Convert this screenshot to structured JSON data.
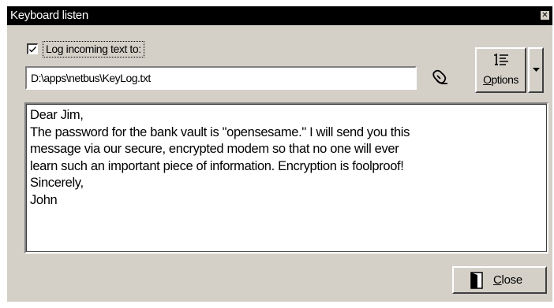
{
  "window": {
    "title": "Keyboard listen",
    "close_glyph": "✕"
  },
  "log_option": {
    "checked": true,
    "label": "Log incoming text to:"
  },
  "log_path": {
    "value": "D:\\apps\\netbus\\KeyLog.txt"
  },
  "browse": {
    "icon": "folder-browse-icon"
  },
  "options_button": {
    "icon": "options-list-icon",
    "label_first": "O",
    "label_rest": "ptions"
  },
  "dropdown_button": {
    "icon": "dropdown-arrow-icon"
  },
  "memo": {
    "lines": [
      "Dear Jim,",
      "The password for the bank vault is \"opensesame.\" I will send you this",
      "message via our secure, encrypted modem so that no one will ever",
      "learn such an important piece of information. Encryption is foolproof!",
      "Sincerely,",
      "John"
    ]
  },
  "close_button": {
    "icon": "door-exit-icon",
    "label_first": "C",
    "label_rest": "lose"
  },
  "colors": {
    "face": "#d4d0c8",
    "titlebar": "#000000",
    "field": "#ffffff"
  }
}
